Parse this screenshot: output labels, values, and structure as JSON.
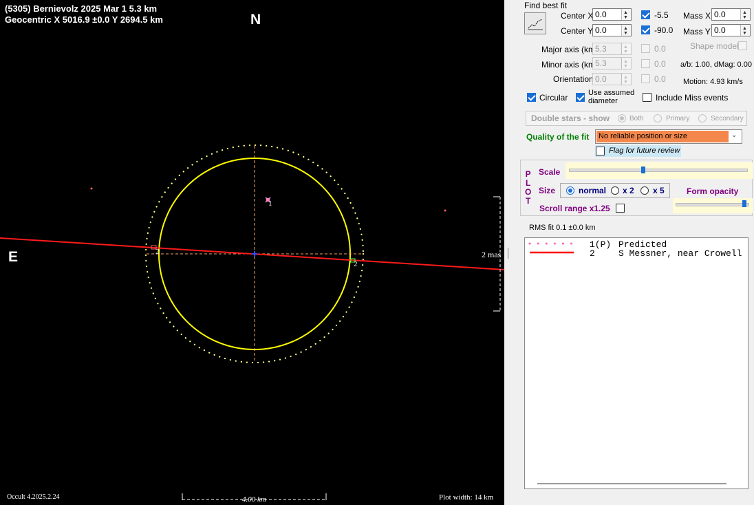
{
  "plot": {
    "title_line1": "(5305) Bernievolz  2025 Mar 1  5.3 km",
    "title_line2": "Geocentric  X  5016.9 ±0.0  Y 2694.5 km",
    "north_label": "N",
    "east_label": "E",
    "scale_mas": "2 mas",
    "scale_km": "4.00 km",
    "version": "Occult 4.2025.2.24",
    "plot_width": "Plot width:  14 km",
    "chord_labels": [
      "1",
      "2",
      "2"
    ],
    "colors": {
      "background": "#000000",
      "fit_ellipse": "#ffff00",
      "chord": "#ff0000",
      "predicted": "#ff69b4",
      "cross": "#f4a460"
    }
  },
  "panel": {
    "find_best_fit": "Find best fit",
    "center_x": {
      "label": "Center X",
      "value": "0.0",
      "check_value": "-5.5",
      "checked": true
    },
    "center_y": {
      "label": "Center Y",
      "value": "0.0",
      "check_value": "-90.0",
      "checked": true
    },
    "mass_x": {
      "label": "Mass X",
      "value": "0.0"
    },
    "mass_y": {
      "label": "Mass Y",
      "value": "0.0"
    },
    "major_axis": {
      "label": "Major axis (km)",
      "value": "5.3",
      "check_value": "0.0"
    },
    "minor_axis": {
      "label": "Minor axis (km)",
      "value": "5.3",
      "check_value": "0.0"
    },
    "orientation": {
      "label": "Orientation",
      "value": "0.0",
      "check_value": "0.0"
    },
    "shape_model": "Shape model",
    "ab_dmag": "a/b: 1.00, dMag: 0.00",
    "motion": "Motion: 4.93 km/s",
    "circular": "Circular",
    "use_assumed_diameter_1": "Use assumed",
    "use_assumed_diameter_2": "diameter",
    "include_miss": "Include Miss events",
    "double_stars": {
      "label": "Double stars - show",
      "both": "Both",
      "primary": "Primary",
      "secondary": "Secondary"
    },
    "quality_label": "Quality of the fit",
    "quality_value": "No reliable position or size",
    "flag_review": "Flag for future review",
    "plot_letters": [
      "P",
      "L",
      "O",
      "T"
    ],
    "scale_label": "Scale",
    "scale_fraction": 0.42,
    "size_label": "Size",
    "size_normal": "normal",
    "size_x2": "x 2",
    "size_x5": "x 5",
    "form_opacity": "Form opacity",
    "opacity_fraction": 0.95,
    "scroll_range": "Scroll range x1.25",
    "rms_fit": "RMS fit 0.1 ±0.0 km",
    "legend": [
      {
        "num": "1(P)",
        "name": "Predicted"
      },
      {
        "num": "2",
        "name": "S Messner, near Crowell"
      }
    ],
    "colors": {
      "quality_bg": "#f4874b",
      "flag_bg": "#cce8f4",
      "plot_purple": "#800080",
      "scale_track_bg": "#fffbd6",
      "checkbox_blue": "#1a6fd6"
    }
  }
}
